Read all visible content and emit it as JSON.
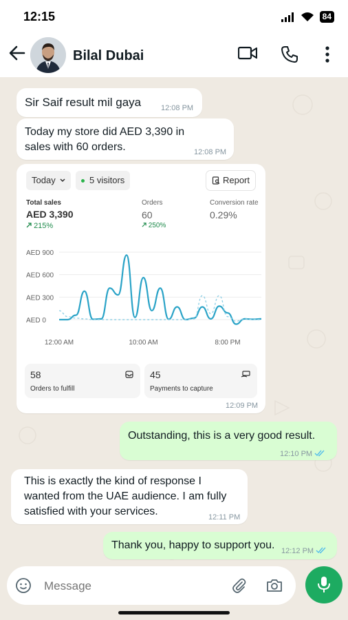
{
  "status_bar": {
    "time": "12:15",
    "battery": "84"
  },
  "header": {
    "contact_name": "Bilal Dubai"
  },
  "messages": [
    {
      "text": "Sir Saif result mil gaya",
      "time": "12:08 PM"
    },
    {
      "line1": "Today my store did AED 3,390 in",
      "line2": "sales with 60 orders.",
      "time": "12:08 PM"
    },
    {
      "time": "12:09 PM"
    },
    {
      "text": "Outstanding, this is a very good result.",
      "time": "12:10 PM"
    },
    {
      "line1": "This is exactly the kind of response I",
      "line2": "wanted from the UAE audience. I am fully",
      "line3": "satisfied with your services.",
      "time": "12:11 PM"
    },
    {
      "text": "Thank you, happy to support you.",
      "time": "12:12 PM"
    }
  ],
  "dashboard": {
    "period": "Today",
    "visitors": "5 visitors",
    "report_label": "Report",
    "metrics": {
      "total_sales": {
        "label": "Total sales",
        "value": "AED 3,390",
        "change": "215%"
      },
      "orders": {
        "label": "Orders",
        "value": "60",
        "change": "250%"
      },
      "conversion": {
        "label": "Conversion rate",
        "value": "0.29%"
      }
    },
    "tiles": [
      {
        "value": "58",
        "label": "Orders to fulfill"
      },
      {
        "value": "45",
        "label": "Payments to capture"
      }
    ],
    "colors": {
      "line": "#2aa3c7",
      "comparison": "#8fd0e6",
      "positive": "#1d8a4a"
    }
  },
  "chart_data": {
    "type": "line",
    "y_tick_labels": [
      "AED 0",
      "AED 300",
      "AED 600",
      "AED 900"
    ],
    "x_tick_labels": [
      "12:00 AM",
      "10:00 AM",
      "8:00 PM"
    ],
    "ylim": [
      0,
      900
    ],
    "xlim": [
      0,
      24
    ],
    "grid": true,
    "series": [
      {
        "x": [
          0,
          1,
          2,
          3,
          4,
          5,
          6,
          7,
          8,
          9,
          10,
          11,
          12,
          13,
          14,
          15,
          16,
          17,
          18,
          19,
          20,
          21,
          22,
          23,
          24
        ],
        "values": [
          0,
          0,
          60,
          380,
          5,
          10,
          420,
          330,
          860,
          30,
          560,
          120,
          420,
          5,
          170,
          0,
          20,
          170,
          10,
          180,
          90,
          -60,
          10,
          5,
          10
        ]
      },
      {
        "x": [
          0,
          1,
          2,
          3,
          4,
          5,
          6,
          7,
          8,
          9,
          10,
          11,
          12,
          13,
          14,
          15,
          16,
          17,
          18,
          19,
          20,
          21,
          22,
          23,
          24
        ],
        "values": [
          120,
          40,
          20,
          10,
          0,
          0,
          0,
          0,
          0,
          0,
          0,
          0,
          0,
          0,
          0,
          0,
          10,
          320,
          80,
          320,
          40,
          -20,
          10,
          0,
          0
        ]
      }
    ]
  },
  "input": {
    "placeholder": "Message"
  }
}
